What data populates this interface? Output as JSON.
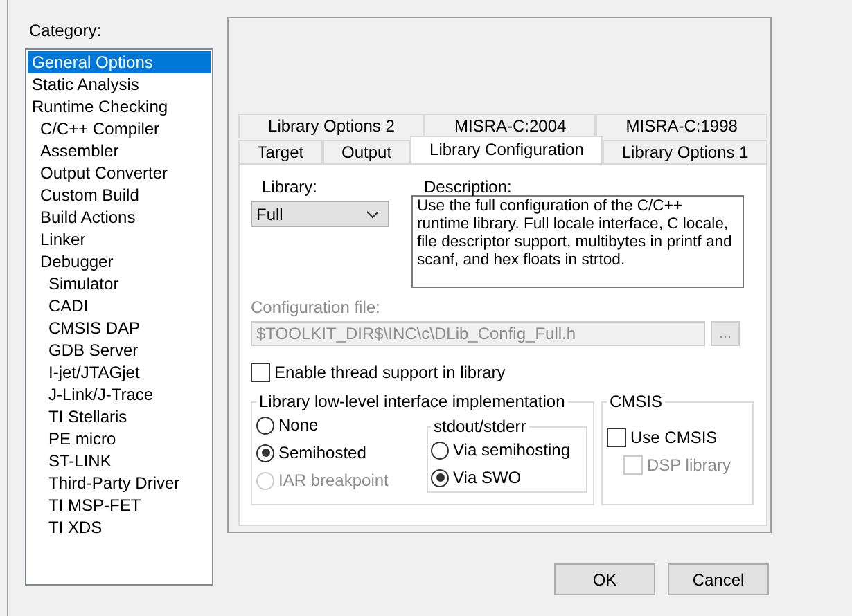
{
  "category": {
    "label": "Category:",
    "items": [
      {
        "label": "General Options",
        "selected": true
      },
      {
        "label": "Static Analysis",
        "selected": false
      },
      {
        "label": "Runtime Checking",
        "selected": false,
        "children": [
          {
            "label": "C/C++ Compiler",
            "selected": false
          },
          {
            "label": "Assembler",
            "selected": false
          },
          {
            "label": "Output Converter",
            "selected": false
          },
          {
            "label": "Custom Build",
            "selected": false
          },
          {
            "label": "Build Actions",
            "selected": false
          },
          {
            "label": "Linker",
            "selected": false
          },
          {
            "label": "Debugger",
            "selected": false,
            "children": [
              {
                "label": "Simulator",
                "selected": false
              },
              {
                "label": "CADI",
                "selected": false
              },
              {
                "label": "CMSIS DAP",
                "selected": false
              },
              {
                "label": "GDB Server",
                "selected": false
              },
              {
                "label": "I-jet/JTAGjet",
                "selected": false
              },
              {
                "label": "J-Link/J-Trace",
                "selected": false
              },
              {
                "label": "TI Stellaris",
                "selected": false
              },
              {
                "label": "PE micro",
                "selected": false
              },
              {
                "label": "ST-LINK",
                "selected": false
              },
              {
                "label": "Third-Party Driver",
                "selected": false
              },
              {
                "label": "TI MSP-FET",
                "selected": false
              },
              {
                "label": "TI XDS",
                "selected": false
              }
            ]
          }
        ]
      }
    ]
  },
  "tabs": [
    [
      {
        "label": "Library Options 2",
        "selected": false
      },
      {
        "label": "MISRA-C:2004",
        "selected": false
      },
      {
        "label": "MISRA-C:1998",
        "selected": false
      }
    ],
    [
      {
        "label": "Target",
        "selected": false
      },
      {
        "label": "Output",
        "selected": false
      },
      {
        "label": "Library Configuration",
        "selected": true
      },
      {
        "label": "Library Options 1",
        "selected": false
      }
    ]
  ],
  "library": {
    "label": "Library:",
    "value": "Full"
  },
  "description": {
    "label": "Description:",
    "text": "Use the full configuration of the C/C++ runtime library. Full locale interface, C locale, file descriptor support, multibytes in printf and scanf, and hex floats in strtod."
  },
  "config_file": {
    "label": "Configuration file:",
    "value": "$TOOLKIT_DIR$\\INC\\c\\DLib_Config_Full.h",
    "disabled": true,
    "browse": "..."
  },
  "thread_support": {
    "label": "Enable thread support in library",
    "checked": false
  },
  "low_level": {
    "title": "Library low-level interface implementation",
    "options": [
      {
        "label": "None",
        "selected": false,
        "disabled": false
      },
      {
        "label": "Semihosted",
        "selected": true,
        "disabled": false
      },
      {
        "label": "IAR breakpoint",
        "selected": false,
        "disabled": true
      }
    ],
    "stdout": {
      "title": "stdout/stderr",
      "options": [
        {
          "label": "Via semihosting",
          "selected": false,
          "disabled": false
        },
        {
          "label": "Via SWO",
          "selected": true,
          "disabled": false
        }
      ]
    }
  },
  "cmsis": {
    "title": "CMSIS",
    "use": {
      "label": "Use CMSIS",
      "checked": false,
      "disabled": false
    },
    "dsp": {
      "label": "DSP library",
      "checked": false,
      "disabled": true
    }
  },
  "buttons": [
    "OK",
    "Cancel"
  ]
}
